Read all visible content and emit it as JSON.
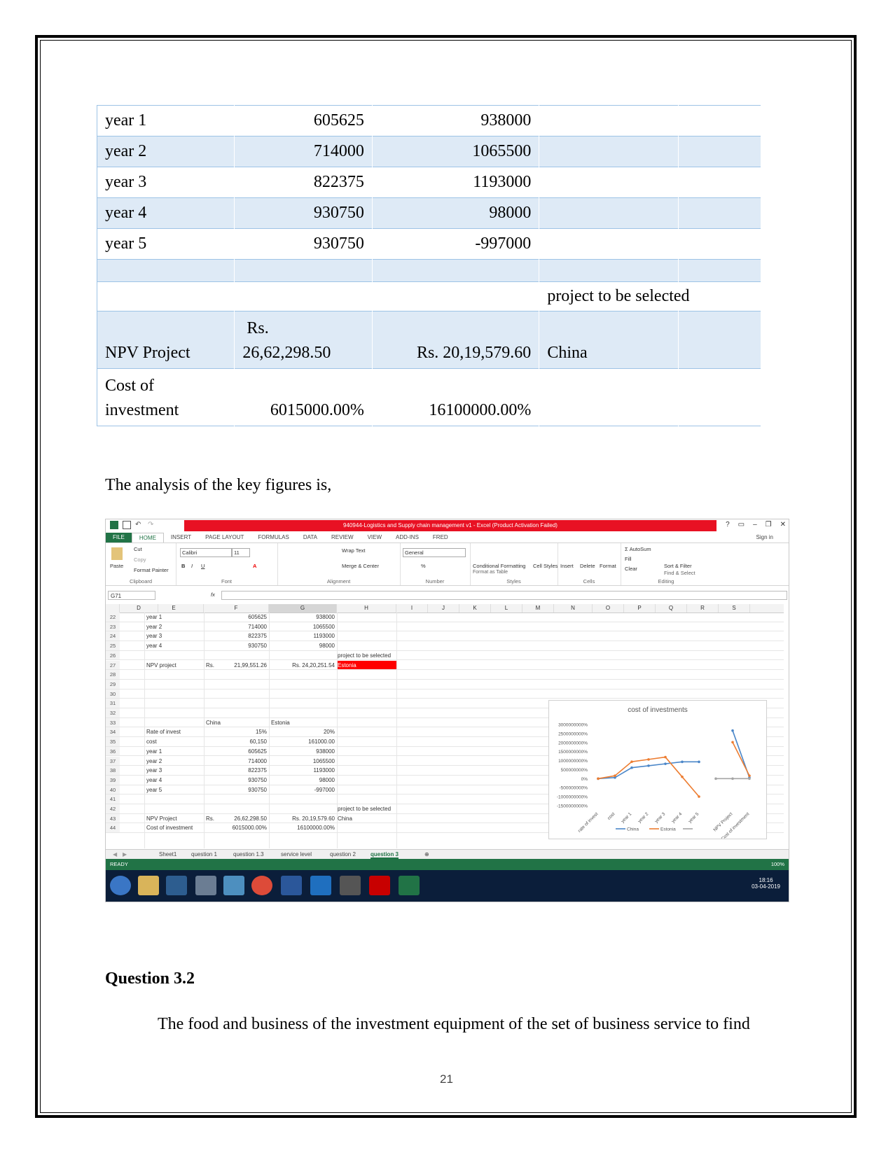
{
  "npv_table": {
    "rows": [
      {
        "label": "year 1",
        "a": "605625",
        "b": "938000"
      },
      {
        "label": "year 2",
        "a": "714000",
        "b": "1065500"
      },
      {
        "label": "year 3",
        "a": "822375",
        "b": "1193000"
      },
      {
        "label": "year 4",
        "a": "930750",
        "b": "98000"
      },
      {
        "label": "year 5",
        "a": "930750",
        "b": "-997000"
      }
    ],
    "selected_label": "project to be selected",
    "npv_label": "NPV Project",
    "npv_a_line1": "Rs.",
    "npv_a_line2": "26,62,298.50",
    "npv_b": "Rs. 20,19,579.60",
    "npv_selected": "China",
    "cost_label_line1": "Cost of",
    "cost_label_line2": "investment",
    "cost_a": "6015000.00%",
    "cost_b": "16100000.00%"
  },
  "analysis_intro": "The analysis of the key figures is,",
  "excel": {
    "title": "940944-Logistics and Supply chain management v1 - Excel (Product Activation Failed)",
    "ribbon_tabs": [
      "FILE",
      "HOME",
      "INSERT",
      "PAGE LAYOUT",
      "FORMULAS",
      "DATA",
      "REVIEW",
      "VIEW",
      "ADD-INS",
      "FRED"
    ],
    "sign_in": "Sign in",
    "clipboard": {
      "paste": "Paste",
      "cut": "Cut",
      "copy": "Copy",
      "format_painter": "Format Painter",
      "label": "Clipboard"
    },
    "font": {
      "name": "Calibri",
      "size": "11",
      "label": "Font"
    },
    "alignment": {
      "wrap": "Wrap Text",
      "merge": "Merge & Center",
      "label": "Alignment"
    },
    "number": {
      "format": "General",
      "label": "Number"
    },
    "styles": {
      "cond": "Conditional Formatting",
      "table": "Format as Table",
      "cell": "Cell Styles",
      "label": "Styles"
    },
    "cells": {
      "insert": "Insert",
      "delete": "Delete",
      "format": "Format",
      "label": "Cells"
    },
    "editing": {
      "autosum": "AutoSum",
      "fill": "Fill",
      "clear": "Clear",
      "sort": "Sort & Filter",
      "find": "Find & Select",
      "label": "Editing"
    },
    "name_box": "G71",
    "columns": [
      "D",
      "E",
      "F",
      "G",
      "H",
      "I",
      "J",
      "K",
      "L",
      "M",
      "N",
      "O",
      "P",
      "Q",
      "R",
      "S"
    ],
    "rows": [
      {
        "n": "22",
        "e": "year 1",
        "f": "605625",
        "g": "938000"
      },
      {
        "n": "23",
        "e": "year 2",
        "f": "714000",
        "g": "1065500"
      },
      {
        "n": "24",
        "e": "year 3",
        "f": "822375",
        "g": "1193000"
      },
      {
        "n": "25",
        "e": "year 4",
        "f": "930750",
        "g": "98000"
      },
      {
        "n": "26",
        "h": "project to be selected"
      },
      {
        "n": "27",
        "e": "NPV project",
        "rs": "Rs.",
        "f": "21,99,551.26",
        "g": "Rs. 24,20,251.54",
        "h": "Estonia"
      },
      {
        "n": "28"
      },
      {
        "n": "29"
      },
      {
        "n": "30"
      },
      {
        "n": "31"
      },
      {
        "n": "32"
      },
      {
        "n": "33",
        "f_left": "China",
        "g_left": "Estonia"
      },
      {
        "n": "34",
        "e": "Rate of invest",
        "f": "15%",
        "g": "20%"
      },
      {
        "n": "35",
        "e": "cost",
        "f": "60,150",
        "g": "161000.00"
      },
      {
        "n": "36",
        "e": "year 1",
        "f": "605625",
        "g": "938000"
      },
      {
        "n": "37",
        "e": "year 2",
        "f": "714000",
        "g": "1065500"
      },
      {
        "n": "38",
        "e": "year 3",
        "f": "822375",
        "g": "1193000"
      },
      {
        "n": "39",
        "e": "year 4",
        "f": "930750",
        "g": "98000"
      },
      {
        "n": "40",
        "e": "year 5",
        "f": "930750",
        "g": "-997000"
      },
      {
        "n": "41"
      },
      {
        "n": "42",
        "h": "project to be selected"
      },
      {
        "n": "43",
        "e": "NPV Project",
        "rs": "Rs.",
        "f": "26,62,298.50",
        "g": "Rs. 20,19,579.60",
        "h": "China"
      },
      {
        "n": "44",
        "e": "Cost of investment",
        "f": "6015000.00%",
        "g": "16100000.00%"
      }
    ],
    "sheet_tabs": [
      "Sheet1",
      "question 1",
      "question 1.3",
      "service level",
      "question 2",
      "question 3"
    ],
    "status_ready": "READY",
    "zoom": "100%",
    "clock_time": "18:16",
    "clock_date": "03-04-2019"
  },
  "chart_data": {
    "type": "line",
    "title": "cost of investments",
    "categories": [
      "rate of invest",
      "cost",
      "year 1",
      "year 2",
      "year 3",
      "year 4",
      "year 5",
      "",
      "NPV Project",
      "Cost of investment"
    ],
    "y_tick_labels": [
      "3000000000%",
      "2500000000%",
      "2000000000%",
      "1500000000%",
      "1000000000%",
      "500000000%",
      "0%",
      "-500000000%",
      "-1000000000%",
      "-1500000000%"
    ],
    "ylim": [
      -1500000000,
      3000000000
    ],
    "series": [
      {
        "name": "China",
        "color": "#4a86c8",
        "values": [
          0.15,
          60150,
          605625,
          714000,
          822375,
          930750,
          930750,
          null,
          2662298.5,
          60150
        ]
      },
      {
        "name": "Estonia",
        "color": "#ed7d31",
        "values": [
          0.2,
          161000,
          938000,
          1065500,
          1193000,
          98000,
          -997000,
          null,
          2019579.6,
          161000
        ]
      },
      {
        "name": "",
        "color": "#a5a5a5",
        "values": [
          null,
          null,
          null,
          null,
          null,
          null,
          null,
          0,
          0,
          0
        ]
      }
    ]
  },
  "question_heading": "Question 3.2",
  "body_text": "The food and business of the investment equipment of the set of business service to find",
  "page_number": "21"
}
